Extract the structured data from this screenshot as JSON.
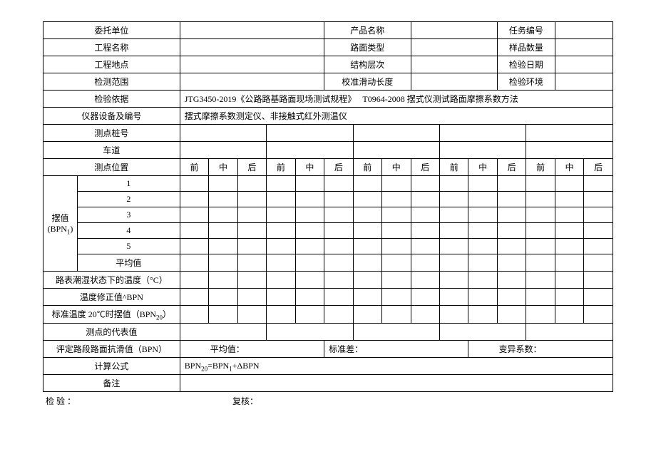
{
  "header": {
    "client_label": "委托单位",
    "product_label": "产品名称",
    "task_no_label": "任务编号",
    "project_label": "工程名称",
    "pavement_type_label": "路面类型",
    "sample_qty_label": "样品数量",
    "location_label": "工程地点",
    "layer_label": "结构层次",
    "inspect_date_label": "检验日期",
    "scope_label": "检测范围",
    "slide_len_label": "校准滑动长度",
    "env_label": "检验环境",
    "basis_label": "检验依据",
    "basis_value": "JTG3450-2019《公路路基路面现场测试规程》　 T0964-2008 摆式仪测试路面摩擦系数方法",
    "equip_label": "仪器设备及编号",
    "equip_value": "摆式摩擦系数测定仪、非接触式红外测温仪"
  },
  "rows": {
    "station_label": "测点桩号",
    "lane_label": "车道",
    "position_label": "测点位置",
    "front": "前",
    "mid": "中",
    "back": "后",
    "bpn_label_line1": "摆值",
    "bpn_label_line2": "(BPN",
    "bpn_label_sub": "1",
    "bpn_label_close": ")",
    "r1": "1",
    "r2": "2",
    "r3": "3",
    "r4": "4",
    "r5": "5",
    "avg": "平均值",
    "wet_temp_label": "路表潮湿状态下的温度（°C）",
    "temp_corr_label_pre": "温度修正值",
    "temp_corr_label_post": "BPN",
    "bpn20_label_pre": "标准温度 20℃时摆值（BPN",
    "bpn20_sub": "20",
    "bpn20_label_post": "）",
    "rep_value_label": "测点的代表值",
    "eval_label": "评定路段路面抗滑值（BPN）",
    "mean_label": "平均值：",
    "std_label": "标准差：",
    "cv_label": "变异系数：",
    "formula_label": "计算公式",
    "formula_pre": "BPN",
    "formula_sub1": "20",
    "formula_mid": "=BPN",
    "formula_sub2": "1",
    "formula_post": "+ΔBPN",
    "remark_label": "备注"
  },
  "footer": {
    "inspector": "检 验 ：",
    "reviewer": "复核："
  }
}
